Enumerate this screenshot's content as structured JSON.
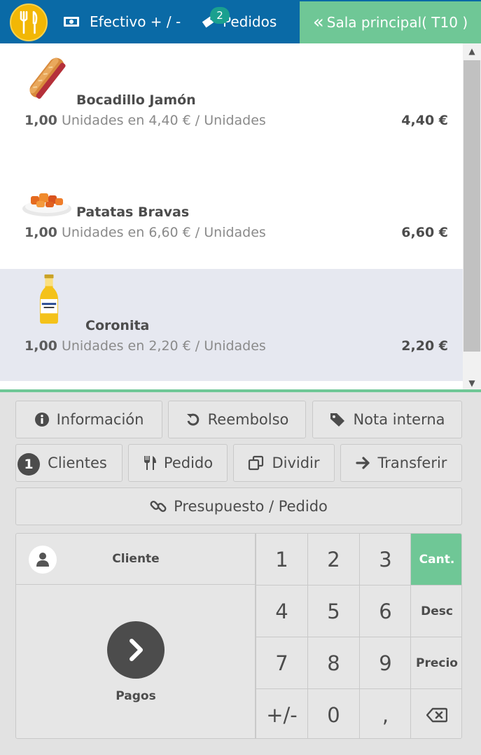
{
  "topbar": {
    "cash_label": "Efectivo + / -",
    "orders_label": "Pedidos",
    "orders_count": "2",
    "room_label": "Sala principal( T10 )"
  },
  "order_lines": [
    {
      "name": "Bocadillo Jamón",
      "quantity": "1,00",
      "details": "Unidades en 4,40 € / Unidades",
      "price": "4,40 €",
      "image_icon": "sandwich-image"
    },
    {
      "name": "Patatas Bravas",
      "quantity": "1,00",
      "details": "Unidades en 6,60 € / Unidades",
      "price": "6,60 €",
      "image_icon": "patatas-bravas-image"
    },
    {
      "name": "Coronita",
      "quantity": "1,00",
      "details": "Unidades en 2,20 € / Unidades",
      "price": "2,20 €",
      "image_icon": "beer-bottle-image",
      "selected": true
    }
  ],
  "actions": {
    "info": "Información",
    "refund": "Reembolso",
    "internal_note": "Nota interna",
    "customers": "Clientes",
    "customers_count": "1",
    "order": "Pedido",
    "split": "Dividir",
    "transfer": "Transferir",
    "quote": "Presupuesto / Pedido"
  },
  "panel": {
    "customer_label": "Cliente",
    "pay_label": "Pagos",
    "keys": [
      "1",
      "2",
      "3",
      "4",
      "5",
      "6",
      "7",
      "8",
      "9",
      "+/-",
      "0",
      ","
    ],
    "mode_qty": "Cant.",
    "mode_disc": "Desc",
    "mode_price": "Precio",
    "active_mode": "Cant."
  },
  "colors": {
    "topbar": "#0a6aa6",
    "accent_green": "#6fc796",
    "selected_line": "#e6e8f0"
  }
}
